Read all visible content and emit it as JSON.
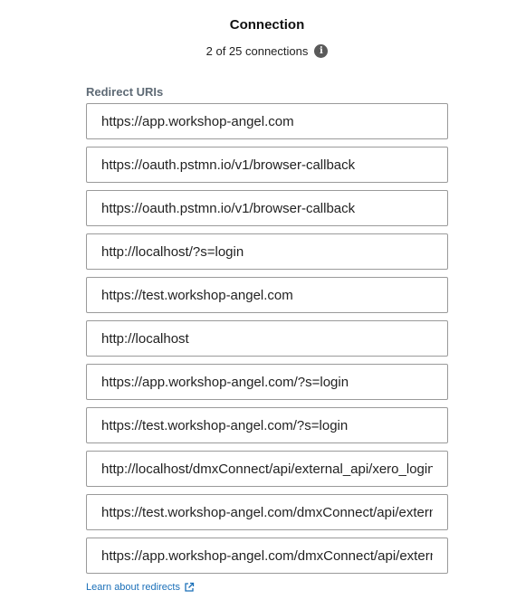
{
  "header": {
    "title": "Connection",
    "connection_count": "2 of 25 connections",
    "info_icon": "info-circle-icon"
  },
  "redirects": {
    "label": "Redirect URIs",
    "uris": [
      "https://app.workshop-angel.com",
      "https://oauth.pstmn.io/v1/browser-callback",
      "https://oauth.pstmn.io/v1/browser-callback",
      "http://localhost/?s=login",
      "https://test.workshop-angel.com",
      "http://localhost",
      "https://app.workshop-angel.com/?s=login",
      "https://test.workshop-angel.com/?s=login",
      "http://localhost/dmxConnect/api/external_api/xero_login",
      "https://test.workshop-angel.com/dmxConnect/api/external_api",
      "https://app.workshop-angel.com/dmxConnect/api/external_api"
    ]
  },
  "footer": {
    "learn_link": "Learn about redirects",
    "link_icon": "external-link-icon"
  },
  "colors": {
    "link": "#1a6fb8",
    "label": "#5e6a75",
    "border": "#9a9a9a"
  }
}
